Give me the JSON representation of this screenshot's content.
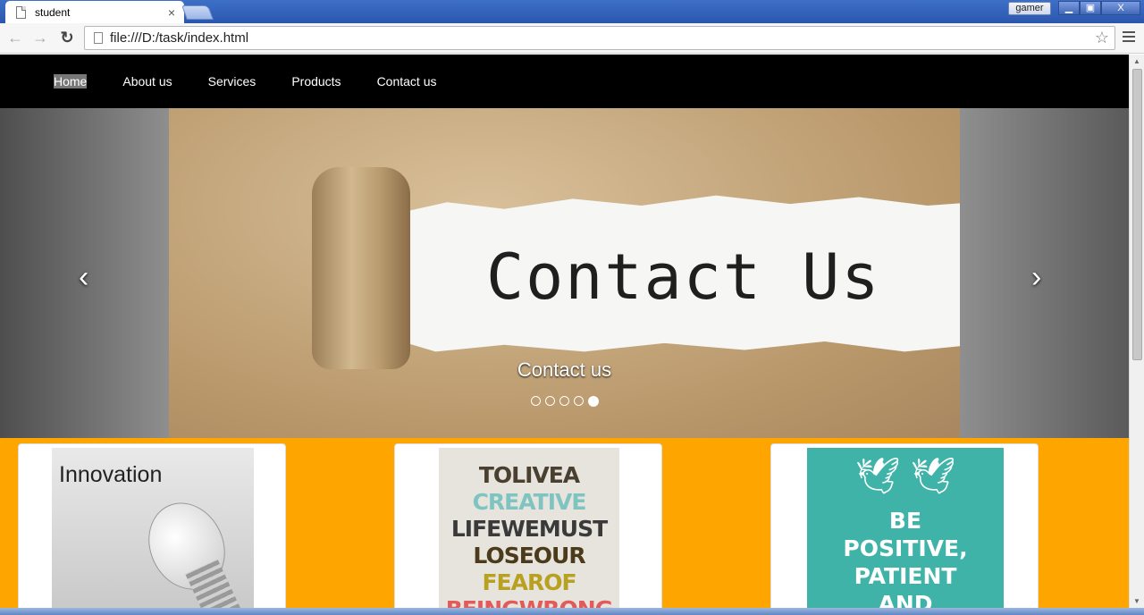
{
  "browser": {
    "tab_title": "student",
    "tab_close": "×",
    "user_label": "gamer",
    "min_label": "▁",
    "max_label": "▣",
    "close_label": "X",
    "back_icon": "←",
    "forward_icon": "→",
    "reload_icon": "↻",
    "url": "file:///D:/task/index.html",
    "star_icon": "☆"
  },
  "nav": {
    "items": [
      {
        "label": "Home",
        "active": true
      },
      {
        "label": "About us"
      },
      {
        "label": "Services"
      },
      {
        "label": "Products"
      },
      {
        "label": "Contact us"
      }
    ]
  },
  "carousel": {
    "slide_text": "Contact Us",
    "caption": "Contact us",
    "prev_icon": "‹",
    "next_icon": "›",
    "indicator_count": 5,
    "active_indicator": 5
  },
  "cards": {
    "innovation": {
      "title": "Innovation"
    },
    "quote": {
      "lines": [
        "TOLIVEA",
        "CREATIVE",
        "LIFEWEMUST",
        "LOSEOUR",
        "FEAROF",
        "BEINGWRONG"
      ]
    },
    "positive": {
      "birds": "🕊 🕊",
      "lines": [
        "BE",
        "POSITIVE,",
        "PATIENT",
        "AND"
      ]
    }
  },
  "scrollbar": {
    "up": "▲",
    "down": "▼"
  }
}
